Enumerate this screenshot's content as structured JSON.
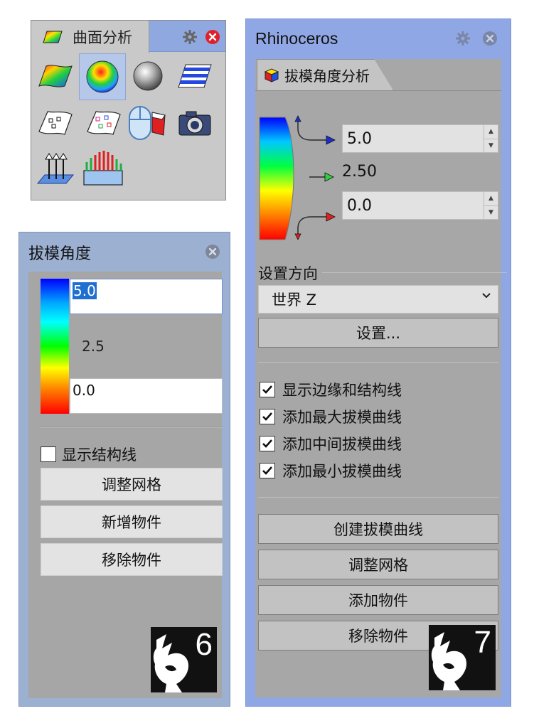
{
  "palette": {
    "tab_label": "曲面分析",
    "tools": [
      {
        "icon": "zebra-curvature-icon"
      },
      {
        "icon": "curvature-sphere-icon"
      },
      {
        "icon": "environment-map-icon"
      },
      {
        "icon": "zebra-stripes-icon"
      },
      {
        "icon": "points-on-surface-icon"
      },
      {
        "icon": "edge-points-icon"
      },
      {
        "icon": "draft-angle-icon"
      },
      {
        "icon": "camera-icon"
      },
      {
        "icon": "surface-normals-icon"
      },
      {
        "icon": "thickness-analysis-icon"
      }
    ]
  },
  "panel6": {
    "title": "拔模角度",
    "max_value": "5.0",
    "mid_value": "2.5",
    "min_value": "0.0",
    "show_isocurves_label": "显示结构线",
    "show_isocurves_checked": false,
    "buttons": [
      "调整网格",
      "新增物件",
      "移除物件"
    ],
    "logo_version": "6"
  },
  "panel7": {
    "title": "Rhinoceros",
    "tab_label": "拔模角度分析",
    "max_value": "5.0",
    "mid_value": "2.50",
    "min_value": "0.0",
    "direction_label": "设置方向",
    "direction_value": "世界 Z",
    "set_button": "设置...",
    "checkboxes": [
      {
        "label": "显示边缘和结构线",
        "checked": true
      },
      {
        "label": "添加最大拔模曲线",
        "checked": true
      },
      {
        "label": "添加中间拔模曲线",
        "checked": true
      },
      {
        "label": "添加最小拔模曲线",
        "checked": true
      }
    ],
    "buttons": [
      "创建拔模曲线",
      "调整网格",
      "添加物件",
      "移除物件"
    ],
    "logo_version": "7"
  }
}
